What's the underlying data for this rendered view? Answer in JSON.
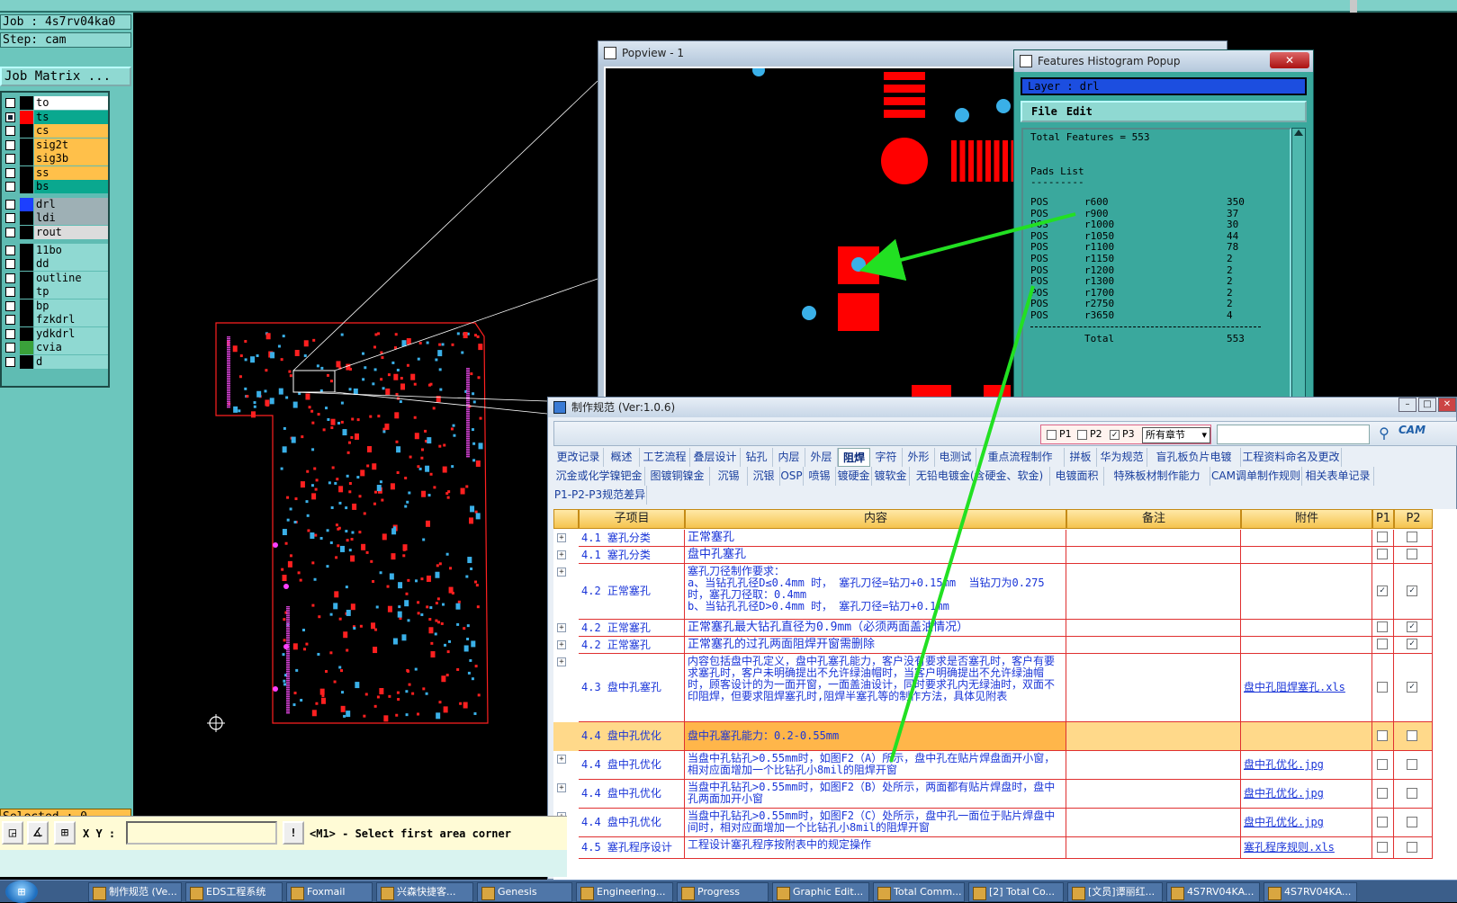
{
  "left_panel": {
    "job": "Job : 4s7rv04ka0",
    "step": "Step: cam",
    "job_matrix": "Job Matrix ...",
    "layers": [
      {
        "name": "to",
        "color": "#000000",
        "bg": "#ffffff",
        "checked": false
      },
      {
        "name": "ts",
        "color": "#ff0000",
        "bg": "#0aa88f",
        "checked": true
      },
      {
        "name": "cs",
        "color": "#000000",
        "bg": "#ffc04a",
        "checked": false
      },
      {
        "name": "sig2t",
        "color": "#000000",
        "bg": "#ffc04a",
        "checked": false
      },
      {
        "name": "sig3b",
        "color": "#000000",
        "bg": "#ffc04a",
        "checked": false
      },
      {
        "name": "ss",
        "color": "#000000",
        "bg": "#ffc04a",
        "checked": false
      },
      {
        "name": "bs",
        "color": "#000000",
        "bg": "#0aa88f",
        "checked": false
      },
      {
        "name": "drl",
        "color": "#1c3fff",
        "bg": "#9eb0b5",
        "checked": false
      },
      {
        "name": "ldi",
        "color": "#000000",
        "bg": "#9eb0b5",
        "checked": false
      },
      {
        "name": "rout",
        "color": "#000000",
        "bg": "#dcdcdc",
        "checked": false
      },
      {
        "name": "11bo",
        "color": "#000000",
        "bg": "#8fd9d2",
        "checked": false
      },
      {
        "name": "dd",
        "color": "#000000",
        "bg": "#8fd9d2",
        "checked": false
      },
      {
        "name": "outline",
        "color": "#000000",
        "bg": "#8fd9d2",
        "checked": false
      },
      {
        "name": "tp",
        "color": "#000000",
        "bg": "#8fd9d2",
        "checked": false
      },
      {
        "name": "bp",
        "color": "#000000",
        "bg": "#8fd9d2",
        "checked": false
      },
      {
        "name": "fzkdrl",
        "color": "#000000",
        "bg": "#8fd9d2",
        "checked": false
      },
      {
        "name": "ydkdrl",
        "color": "#000000",
        "bg": "#8fd9d2",
        "checked": false
      },
      {
        "name": "cvia",
        "color": "#3aa13a",
        "bg": "#8fd9d2",
        "checked": false
      },
      {
        "name": "d",
        "color": "#000000",
        "bg": "#8fd9d2",
        "checked": false
      }
    ],
    "selected": "Selected : 0"
  },
  "bottom_bar": {
    "xy_label": "X Y :",
    "xy_value": "",
    "warn": "!",
    "status": "<M1> - Select first area corner"
  },
  "popview": {
    "title": "Popview - 1"
  },
  "histogram": {
    "title": "Features Histogram Popup",
    "close": "✕",
    "layer": "Layer :  drl",
    "menu": [
      "File",
      "Edit"
    ],
    "total_features": "Total Features = 553",
    "pads_list": "Pads List",
    "dashes": "---------",
    "rows": [
      {
        "t": "POS",
        "sym": "r600",
        "n": "350"
      },
      {
        "t": "POS",
        "sym": "r900",
        "n": "37"
      },
      {
        "t": "POS",
        "sym": "r1000",
        "n": "30"
      },
      {
        "t": "POS",
        "sym": "r1050",
        "n": "44"
      },
      {
        "t": "POS",
        "sym": "r1100",
        "n": "78"
      },
      {
        "t": "POS",
        "sym": "r1150",
        "n": "2"
      },
      {
        "t": "POS",
        "sym": "r1200",
        "n": "2"
      },
      {
        "t": "POS",
        "sym": "r1300",
        "n": "2"
      },
      {
        "t": "POS",
        "sym": "r1700",
        "n": "2"
      },
      {
        "t": "POS",
        "sym": "r2750",
        "n": "2"
      },
      {
        "t": "POS",
        "sym": "r3650",
        "n": "4"
      }
    ],
    "total_label": "Total",
    "total_value": "553"
  },
  "spec": {
    "title": "制作规范 (Ver:1.0.6)",
    "filters": [
      "P1",
      "P2",
      "P3"
    ],
    "filter_checked": [
      false,
      false,
      true
    ],
    "chapter": "所有章节",
    "search_value": "",
    "cam_logo": "CAM",
    "tabs_row1": [
      "更改记录",
      "概述",
      "工艺流程",
      "叠层设计",
      "钻孔",
      "内层",
      "外层",
      "阻焊",
      "字符",
      "外形",
      "电测试",
      "重点流程制作",
      "拼板",
      "华为规范",
      "盲孔板负片电镀",
      "工程资料命名及更改"
    ],
    "tabs_row2": [
      "沉金或化学镍钯金",
      "图镀铜镍金",
      "沉锡",
      "沉银",
      "OSP",
      "喷锡",
      "镀硬金",
      "镀软金",
      "无铅电镀金(含硬金、软金)",
      "电镀面积",
      "特殊板材制作能力",
      "CAM调单制作规则",
      "相关表单记录"
    ],
    "tabs_row3": [
      "P1-P2-P3规范差异"
    ],
    "active_tab": "阻焊",
    "headers": [
      "子项目",
      "内容",
      "备注",
      "附件",
      "P1",
      "P2"
    ],
    "rows": [
      {
        "sub": "4.1 塞孔分类",
        "content": "正常塞孔",
        "note": "",
        "attach": "",
        "p1": false,
        "p2": false
      },
      {
        "sub": "4.1 塞孔分类",
        "content": "盘中孔塞孔",
        "note": "",
        "attach": "",
        "p1": false,
        "p2": false
      },
      {
        "sub": "4.2 正常塞孔",
        "content": "塞孔刀径制作要求：\na、当钻孔孔径D≤0.4mm 时， 塞孔刀径=钻刀+0.15mm  当钻刀为0.275时，塞孔刀径取：0.4mm\nb、当钻孔孔径D>0.4mm 时， 塞孔刀径=钻刀+0.1mm",
        "note": "",
        "attach": "",
        "p1": true,
        "p2": true
      },
      {
        "sub": "4.2 正常塞孔",
        "content": "正常塞孔最大钻孔直径为0.9mm（必须两面盖油情况）",
        "note": "",
        "attach": "",
        "p1": false,
        "p2": true
      },
      {
        "sub": "4.2 正常塞孔",
        "content": "正常塞孔的过孔两面阻焊开窗需删除",
        "note": "",
        "attach": "",
        "p1": false,
        "p2": true
      },
      {
        "sub": "4.3 盘中孔塞孔",
        "content": "内容包括盘中孔定义，盘中孔塞孔能力，客户没有要求是否塞孔时，客户有要求塞孔时，客户未明确提出不允许绿油帽时，当客户明确提出不允许绿油帽时，顾客设计的为一面开窗，一面盖油设计，同时要求孔内无绿油时，双面不印阻焊，但要求阻焊塞孔时,阻焊半塞孔等的制作方法，具体见附表",
        "note": "",
        "attach": "盘中孔阻焊塞孔.xls",
        "p1": false,
        "p2": true
      },
      {
        "sub": "4.4 盘中孔优化",
        "content": "盘中孔塞孔能力：0.2-0.55mm",
        "note": "",
        "attach": "",
        "p1": false,
        "p2": false,
        "highlight": true
      },
      {
        "sub": "4.4 盘中孔优化",
        "content": "当盘中孔钻孔>0.55mm时，如图F2（A）所示，盘中孔在贴片焊盘面开小窗，相对应面增加一个比钻孔小8mil的阻焊开窗",
        "note": "",
        "attach": "盘中孔优化.jpg",
        "p1": false,
        "p2": false
      },
      {
        "sub": "4.4 盘中孔优化",
        "content": "当盘中孔钻孔>0.55mm时，如图F2（B）处所示，两面都有贴片焊盘时，盘中孔两面加开小窗",
        "note": "",
        "attach": "盘中孔优化.jpg",
        "p1": false,
        "p2": false
      },
      {
        "sub": "4.4 盘中孔优化",
        "content": "当盘中孔钻孔>0.55mm时，如图F2（C）处所示，盘中孔一面位于贴片焊盘中间时，相对应面增加一个比钻孔小8mil的阻焊开窗",
        "note": "",
        "attach": "盘中孔优化.jpg",
        "p1": false,
        "p2": false
      },
      {
        "sub": "4.5 塞孔程序设计",
        "content": "工程设计塞孔程序按附表中的规定操作",
        "note": "",
        "attach": "塞孔程序规则.xls",
        "p1": false,
        "p2": false
      }
    ]
  },
  "taskbar": {
    "items": [
      "制作规范 (Ve...",
      "EDS工程系统",
      "Foxmail",
      "兴森快捷客...",
      "Genesis",
      "Engineering...",
      "Progress",
      "Graphic Edit...",
      "Total Comm...",
      "[2] Total Co...",
      "[文员]谭丽红...",
      "4S7RV04KA...",
      "4S7RV04KA..."
    ]
  },
  "colors": {
    "pad_red": "#ff0000",
    "drill_blue": "#3ab0e8",
    "arrow_green": "#22e022"
  }
}
